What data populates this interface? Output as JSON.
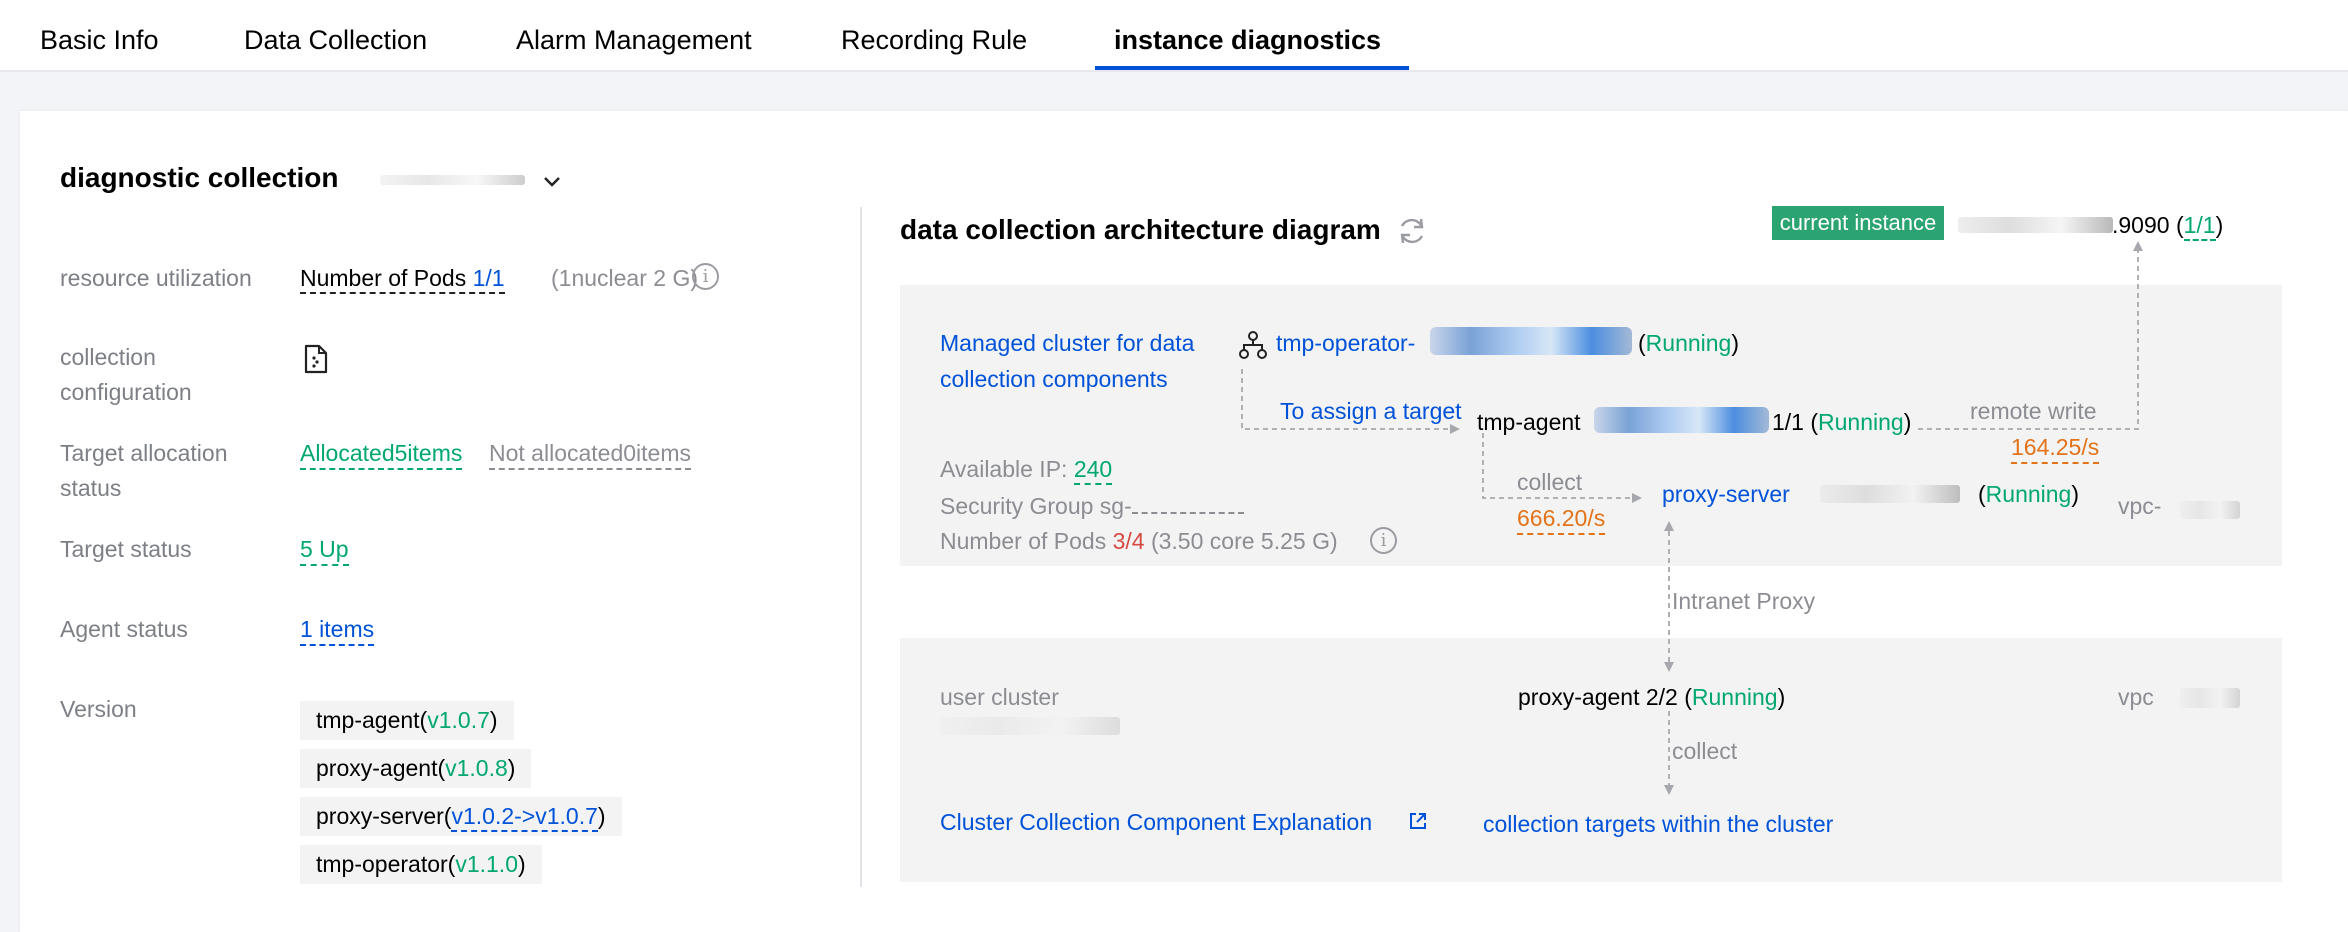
{
  "tabs": [
    "Basic Info",
    "Data Collection",
    "Alarm Management",
    "Recording Rule",
    "instance diagnostics"
  ],
  "left": {
    "title": "diagnostic collection",
    "rows": {
      "resource_label": "resource utilization",
      "pods_label": "Number of Pods ",
      "pods_value": "1/1",
      "pods_spec": "(1nuclear 2 G)",
      "config_label_1": "collection",
      "config_label_2": "configuration",
      "alloc_label_1": "Target allocation",
      "alloc_label_2": "status",
      "allocated": "Allocated5items",
      "not_allocated": "Not allocated0items",
      "target_status_label": "Target status",
      "target_status_value": "5 Up",
      "agent_status_label": "Agent status",
      "agent_status_value": "1 items",
      "version_label": "Version"
    },
    "versions": [
      {
        "name": "tmp-agent(",
        "ver": "v1.0.7",
        "close": ")"
      },
      {
        "name": "proxy-agent(",
        "ver": "v1.0.8",
        "close": ")"
      },
      {
        "name": "proxy-server(",
        "ver": "v1.0.2->v1.0.7",
        "close": ")"
      },
      {
        "name": "tmp-operator(",
        "ver": "v1.1.0",
        "close": ")"
      }
    ]
  },
  "right": {
    "title": "data collection architecture diagram",
    "current_instance": "current instance",
    "instance_suffix": ".9090 (",
    "instance_count": "1/1",
    "instance_close": ")",
    "managed_1": "Managed cluster for data",
    "managed_2": "collection components",
    "operator": "tmp-operator-",
    "running": "Running",
    "assign": "To assign a target",
    "agent": "tmp-agent",
    "agent_count": "1/1 (",
    "remote_write": "remote write",
    "remote_rate": "164.25/s",
    "available_ip_label": "Available IP: ",
    "available_ip": "240",
    "security_group": "Security Group sg-",
    "pods_label": "Number of Pods ",
    "pods_value": "3/4",
    "pods_spec": " (3.50 core 5.25 G)",
    "collect": "collect",
    "collect_rate": "666.20/s",
    "proxy_server": "proxy-server",
    "vpc": "vpc-",
    "intranet": "Intranet Proxy",
    "user_cluster": "user cluster",
    "proxy_agent": "proxy-agent 2/2 (",
    "vpc2": "vpc",
    "collect2": "collect",
    "explanation": "Cluster Collection Component Explanation",
    "targets": "collection targets within the cluster"
  },
  "colors": {
    "accent": "#0052d9",
    "success": "#00a870",
    "warning": "#e37318",
    "danger": "#d54941",
    "badge": "#2ba471"
  },
  "icons": [
    "chevron-down-icon",
    "info-icon",
    "document-icon",
    "refresh-icon",
    "cluster-icon",
    "external-link-icon"
  ]
}
